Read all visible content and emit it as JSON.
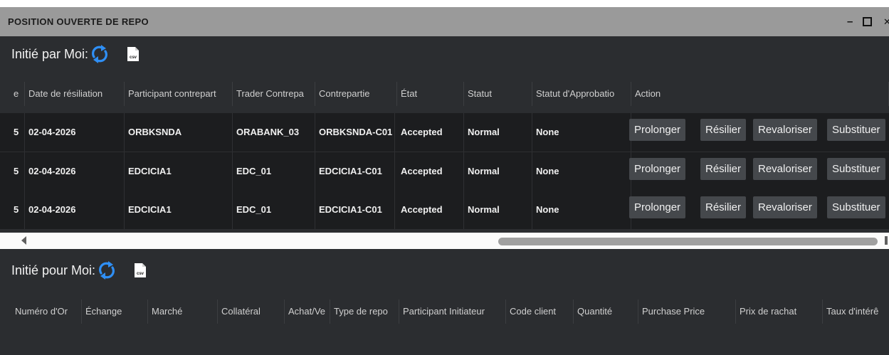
{
  "window": {
    "title": "POSITION OUVERTE DE REPO",
    "controls": {
      "minimize": "–",
      "close": "✕"
    }
  },
  "section1": {
    "title": "Initié par Moi:",
    "columns": [
      "e",
      "Date de résiliation",
      "Participant contrepart",
      "Trader Contrepa",
      "Contrepartie",
      "État",
      "Statut",
      "Statut d'Approbatio",
      "Action"
    ],
    "rows": [
      {
        "lead": "5",
        "date": "02-04-2026",
        "participant": "ORBKSNDA",
        "trader": "ORABANK_03",
        "counterparty": "ORBKSNDA-C01",
        "state": "Accepted",
        "status": "Normal",
        "approval": "None"
      },
      {
        "lead": "5",
        "date": "02-04-2026",
        "participant": "EDCICIA1",
        "trader": "EDC_01",
        "counterparty": "EDCICIA1-C01",
        "state": "Accepted",
        "status": "Normal",
        "approval": "None"
      },
      {
        "lead": "5",
        "date": "02-04-2026",
        "participant": "EDCICIA1",
        "trader": "EDC_01",
        "counterparty": "EDCICIA1-C01",
        "state": "Accepted",
        "status": "Normal",
        "approval": "None"
      }
    ],
    "actions": [
      "Prolonger",
      "Résilier",
      "Revaloriser",
      "Substituer"
    ]
  },
  "section2": {
    "title": "Initié pour Moi:",
    "columns": [
      "Numéro d'Or",
      "Échange",
      "Marché",
      "Collatéral",
      "Achat/Ve",
      "Type de repo",
      "Participant Initiateur",
      "Code client",
      "Quantité",
      "Purchase Price",
      "Prix de rachat",
      "Taux d'intérê"
    ]
  },
  "icons": {
    "refresh": "refresh-icon",
    "csv": "csv-export-icon",
    "csv_label": "csv"
  },
  "colors": {
    "accent": "#2f8ff5",
    "row_bg": "#1c1d1f",
    "window_bg": "#2b2d30",
    "button_bg": "#45484c",
    "titlebar_bg": "#9a9a9a"
  }
}
